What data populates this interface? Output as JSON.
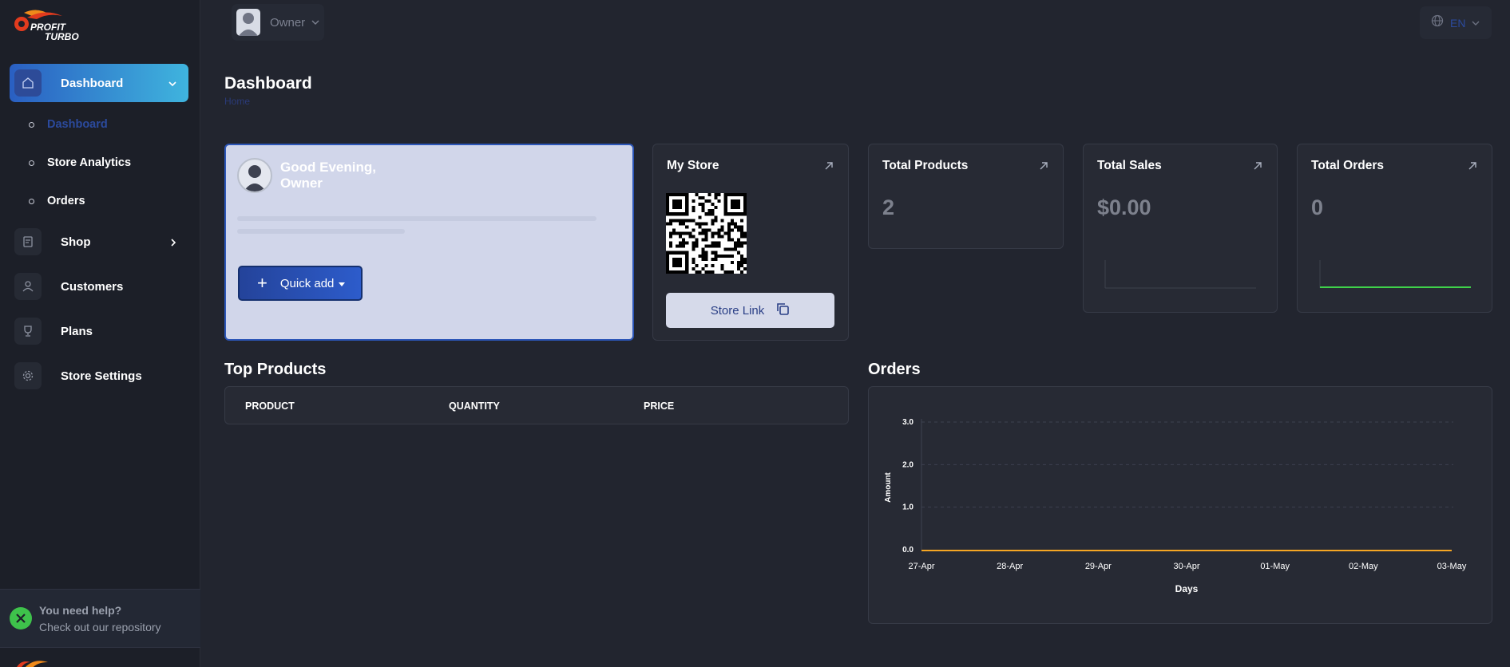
{
  "brand": {
    "line1": "PROFIT",
    "line2": "TURBO"
  },
  "sidebar": {
    "items": [
      {
        "label": "Dashboard",
        "icon": "home-icon",
        "active": true,
        "expanded": true
      },
      {
        "label": "Shop",
        "icon": "shop-icon"
      },
      {
        "label": "Customers",
        "icon": "user-icon"
      },
      {
        "label": "Plans",
        "icon": "trophy-icon"
      },
      {
        "label": "Store Settings",
        "icon": "gear-icon"
      }
    ],
    "subitems": [
      {
        "label": "Dashboard",
        "active": true
      },
      {
        "label": "Store Analytics"
      },
      {
        "label": "Orders"
      }
    ],
    "help": {
      "title": "You need help?",
      "subtitle": "Check out our repository"
    }
  },
  "header": {
    "user": "Owner",
    "language": "EN"
  },
  "page": {
    "title": "Dashboard",
    "breadcrumb": "Home"
  },
  "welcome": {
    "greeting": "Good Evening,",
    "name": "Owner",
    "quick_add": "Quick add"
  },
  "cards": {
    "my_store": {
      "title": "My Store",
      "store_link": "Store Link"
    },
    "total_products": {
      "title": "Total Products",
      "value": "2"
    },
    "total_sales": {
      "title": "Total Sales",
      "value": "$0.00"
    },
    "total_orders": {
      "title": "Total Orders",
      "value": "0"
    }
  },
  "top_products": {
    "title": "Top Products",
    "columns": [
      "PRODUCT",
      "QUANTITY",
      "PRICE"
    ]
  },
  "orders": {
    "title": "Orders"
  },
  "colors": {
    "accent": "#2c56b8",
    "gradient_end": "#3fb4de",
    "line_orange": "#f5a623",
    "line_green": "#3fd14a"
  },
  "chart_data": {
    "type": "line",
    "x": [
      "27-Apr",
      "28-Apr",
      "29-Apr",
      "30-Apr",
      "01-May",
      "02-May",
      "03-May"
    ],
    "series": [
      {
        "values": [
          0,
          0,
          0,
          0,
          0,
          0,
          0
        ]
      }
    ],
    "yticks": [
      "0.0",
      "1.0",
      "2.0",
      "3.0"
    ],
    "ylim": [
      0,
      3
    ],
    "xlabel": "Days",
    "ylabel": "Amount",
    "grid": true
  }
}
